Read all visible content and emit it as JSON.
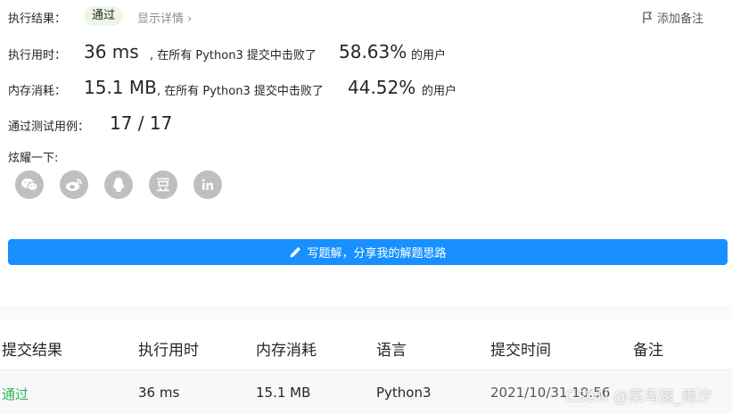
{
  "result": {
    "label": "执行结果：",
    "status": "通过",
    "detail_link": "显示详情",
    "add_note": "添加备注"
  },
  "runtime": {
    "label": "执行用时：",
    "value": "36 ms",
    "mid": ", 在所有 Python3 提交中击败了",
    "percent": "58.63%",
    "suffix": "的用户"
  },
  "memory": {
    "label": "内存消耗：",
    "value": "15.1 MB",
    "mid": ", 在所有 Python3 提交中击败了",
    "percent": "44.52%",
    "suffix": "的用户"
  },
  "testcases": {
    "label": "通过测试用例：",
    "value": "17 / 17"
  },
  "share": {
    "label": "炫耀一下:",
    "icons": [
      "wechat-icon",
      "weibo-icon",
      "qq-icon",
      "douban-icon",
      "linkedin-icon"
    ]
  },
  "solution_button": "写题解，分享我的解题思路",
  "table": {
    "headers": [
      "提交结果",
      "执行用时",
      "内存消耗",
      "语言",
      "提交时间",
      "备注"
    ],
    "row": {
      "status": "通过",
      "runtime": "36 ms",
      "memory": "15.1 MB",
      "language": "Python3",
      "time": "2021/10/31 10:56"
    }
  },
  "watermark": "CSDN @菜鸟猿_雨汐",
  "colors": {
    "accent": "#1890ff",
    "success": "#2db55d",
    "badge_bg": "#ecf6e6",
    "icon_gray": "#bfbfbf"
  }
}
